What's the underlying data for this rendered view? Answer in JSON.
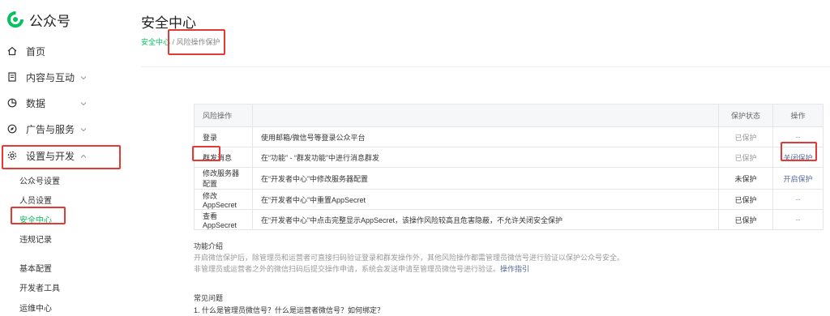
{
  "brand": {
    "name": "公众号",
    "accent": "#07c160",
    "highlight": "#e53935"
  },
  "nav": {
    "home": {
      "label": "首页",
      "icon": "home-icon"
    },
    "content": {
      "label": "内容与互动",
      "icon": "document-icon"
    },
    "data": {
      "label": "数据",
      "icon": "pie-chart-icon"
    },
    "ads": {
      "label": "广告与服务",
      "icon": "compass-icon"
    },
    "settings": {
      "label": "设置与开发",
      "icon": "gear-icon",
      "sub": [
        "公众号设置",
        "人员设置",
        "安全中心",
        "违规记录",
        "基本配置",
        "开发者工具",
        "运维中心"
      ],
      "active": "安全中心"
    }
  },
  "page": {
    "title": "安全中心",
    "breadcrumb": {
      "parent": "安全中心",
      "separator": " / ",
      "current": "风险操作保护"
    }
  },
  "table": {
    "headers": {
      "name": "风险操作",
      "desc": "",
      "status": "保护状态",
      "op": "操作"
    },
    "rows": [
      {
        "name": "登录",
        "desc": "使用邮箱/微信号等登录公众平台",
        "status": "已保护",
        "op": "--"
      },
      {
        "name": "群发消息",
        "desc": "在“功能” - “群发功能”中进行消息群发",
        "status": "已保护",
        "op": "关闭保护"
      },
      {
        "name": "修改服务器配置",
        "desc": "在“开发者中心”中修改服务器配置",
        "status": "未保护",
        "op": "开启保护"
      },
      {
        "name": "修改AppSecret",
        "desc": "在“开发者中心”中重置AppSecret",
        "status": "已保护",
        "op": "--"
      },
      {
        "name": "查看AppSecret",
        "desc": "在“开发者中心”中点击完整显示AppSecret，该操作风险较高且危害隐蔽，不允许关闭安全保护",
        "status": "已保护",
        "op": "--"
      }
    ]
  },
  "intro": {
    "title": "功能介绍",
    "line1": "开启微信保护后，除管理员和运营者可直接扫码验证登录和群发操作外，其他风险操作都需管理员微信号进行验证以保护公众号安全。",
    "line2": "非管理员或运营者之外的微信扫码后提交操作申请，系统会发送申请至管理员微信号进行验证。",
    "guide": "操作指引"
  },
  "faq": {
    "title": "常见问题",
    "q1": "1. 什么是管理员微信号？什么是运营者微信号？如何绑定？"
  }
}
